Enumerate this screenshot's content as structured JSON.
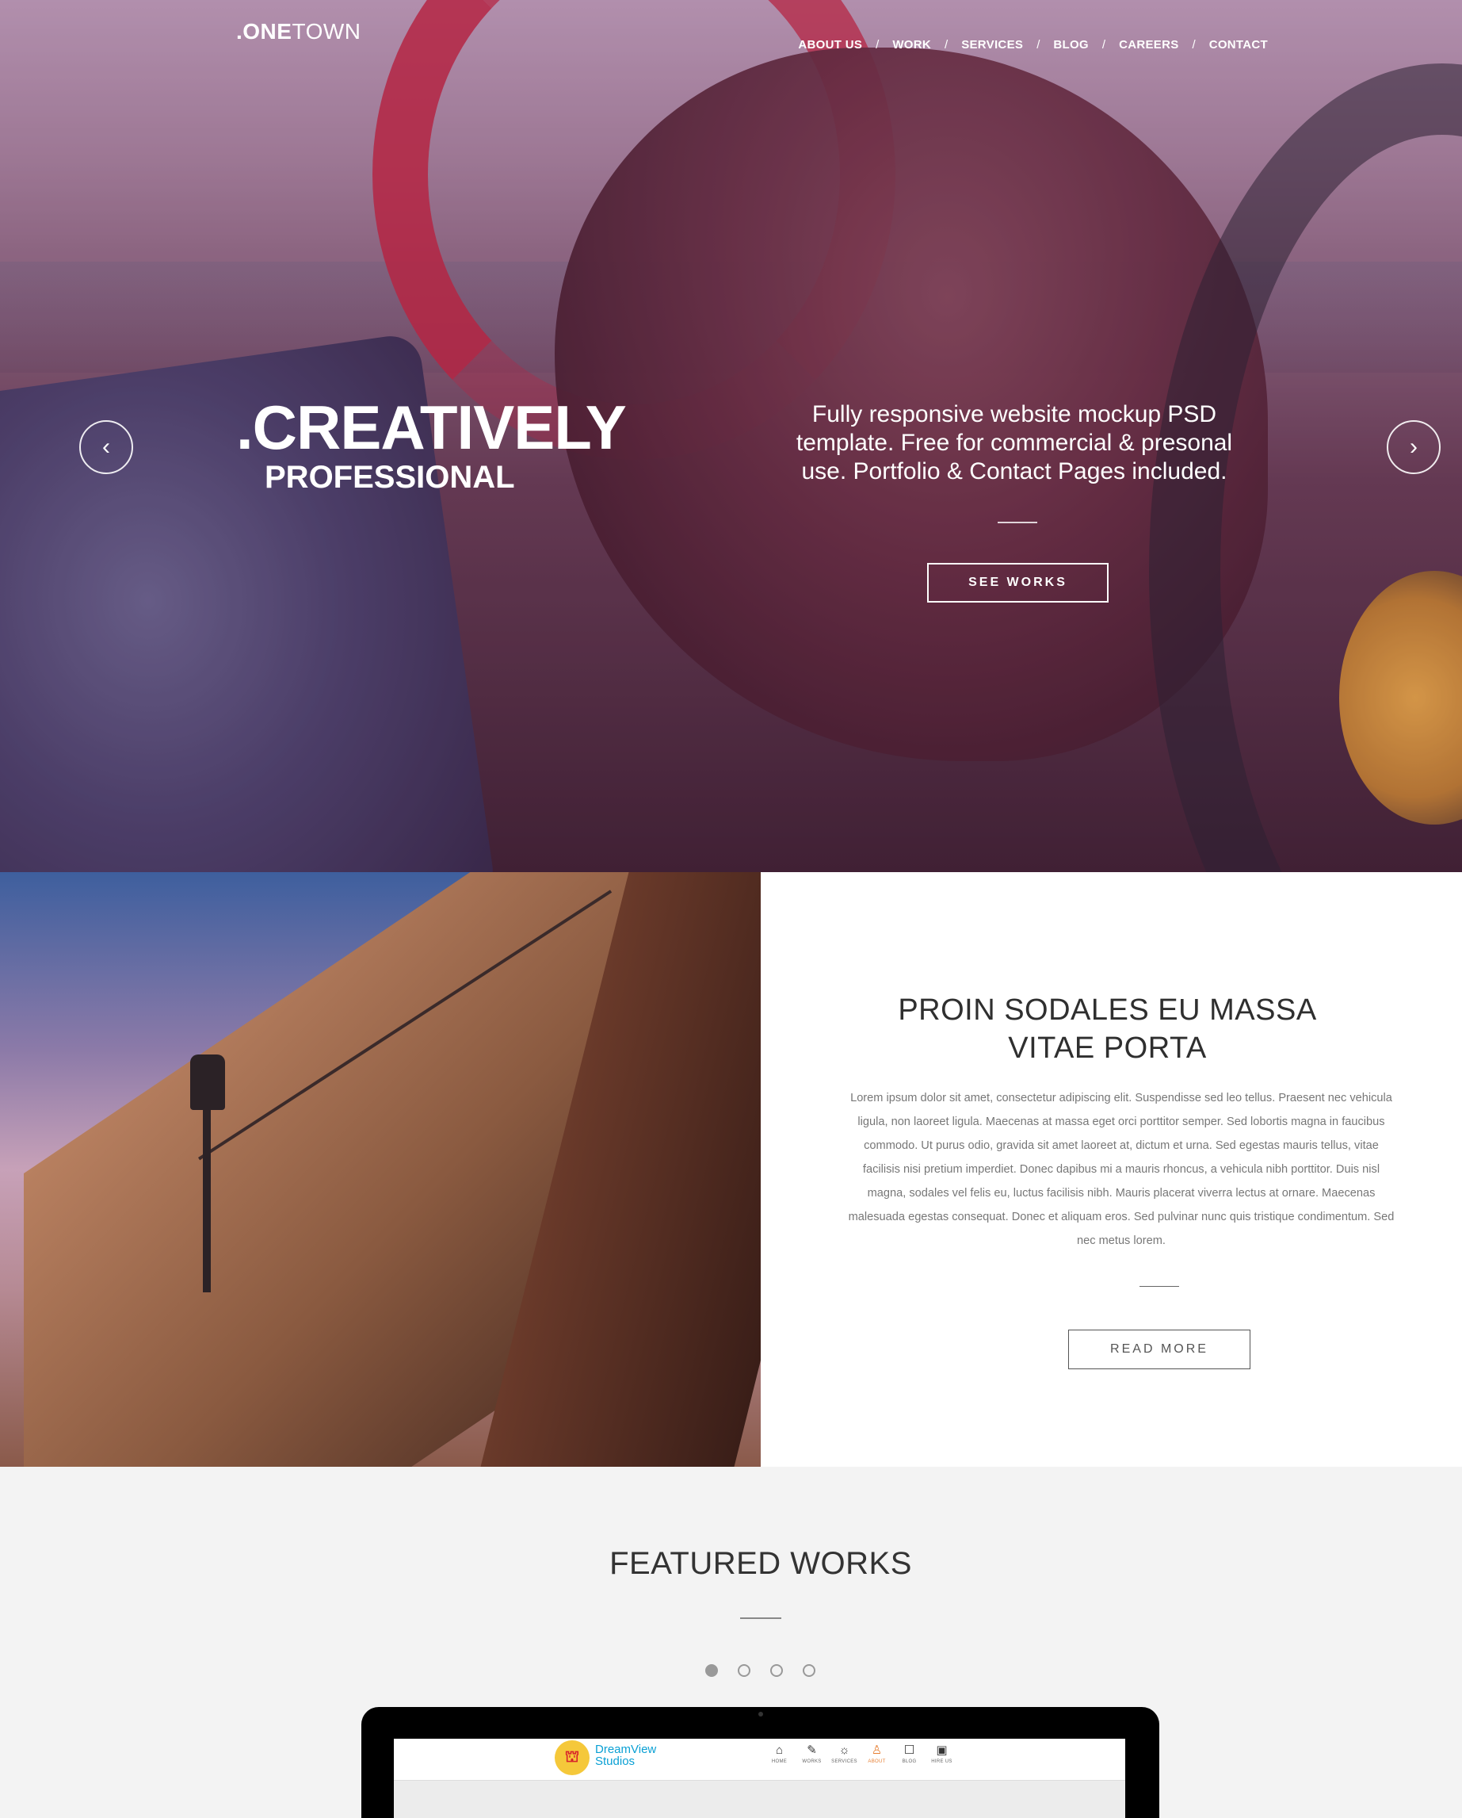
{
  "brand": {
    "dot": ".",
    "one": "ONE",
    "town": "TOWN"
  },
  "nav": {
    "items": [
      "ABOUT US",
      "WORK",
      "SERVICES",
      "BLOG",
      "CAREERS",
      "CONTACT"
    ],
    "separator": "/"
  },
  "hero": {
    "headline_dot": ".",
    "headline": "CREATIVELY",
    "subheadline": "PROFESSIONAL",
    "description": "Fully responsive website mockup PSD template. Free for commercial & presonal use.  Portfolio & Contact Pages included.",
    "cta": "SEE WORKS",
    "prev_icon": "‹",
    "next_icon": "›"
  },
  "about": {
    "title_line1": "PROIN SODALES EU MASSA",
    "title_line2": "VITAE PORTA",
    "body": "Lorem ipsum dolor sit amet, consectetur adipiscing elit. Suspendisse sed leo tellus. Praesent nec vehicula ligula, non laoreet ligula. Maecenas at massa eget orci porttitor semper. Sed lobortis magna in faucibus commodo. Ut purus odio, gravida sit amet laoreet at, dictum et urna. Sed egestas mauris tellus, vitae facilisis nisi pretium imperdiet. Donec dapibus mi a mauris rhoncus, a vehicula nibh porttitor. Duis nisl magna, sodales vel felis eu, luctus facilisis nibh. Mauris placerat viverra lectus at ornare. Maecenas malesuada egestas consequat. Donec et aliquam eros. Sed pulvinar nunc quis tristique condimentum. Sed nec metus lorem.",
    "cta": "READ MORE"
  },
  "featured": {
    "title": "FEATURED WORKS",
    "carousel": {
      "count": 4,
      "active": 0
    }
  },
  "mockup": {
    "brand_line1": "DreamView",
    "brand_line2": "Studios",
    "menu": [
      {
        "icon": "⌂",
        "label": "HOME"
      },
      {
        "icon": "✎",
        "label": "WORKS"
      },
      {
        "icon": "☼",
        "label": "SERVICES"
      },
      {
        "icon": "♙",
        "label": "ABOUT"
      },
      {
        "icon": "☐",
        "label": "BLOG"
      },
      {
        "icon": "▣",
        "label": "HIRE US"
      }
    ],
    "active_menu": 3
  },
  "colors": {
    "hero_tint": "#6b4058",
    "mockup_brand": "#0aa0d4",
    "mockup_active": "#e67f32"
  }
}
